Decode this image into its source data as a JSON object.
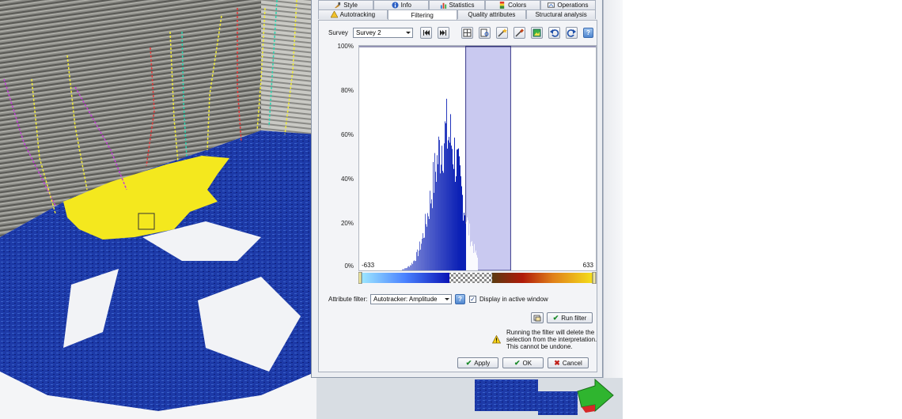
{
  "tabs_row1": [
    {
      "label": "Style",
      "icon": "brush-icon"
    },
    {
      "label": "Info",
      "icon": "info-icon"
    },
    {
      "label": "Statistics",
      "icon": "statistics-icon"
    },
    {
      "label": "Colors",
      "icon": "colors-icon"
    },
    {
      "label": "Operations",
      "icon": "operations-icon"
    }
  ],
  "tabs_row2": [
    {
      "label": "Autotracking",
      "icon": "autotracking-icon",
      "active": false
    },
    {
      "label": "Filtering",
      "icon": "",
      "active": true
    },
    {
      "label": "Quality attributes",
      "icon": "",
      "active": false
    },
    {
      "label": "Structural analysis",
      "icon": "",
      "active": false
    }
  ],
  "survey": {
    "label": "Survey",
    "value": "Survey 2"
  },
  "toolbar_icons": [
    "first-icon",
    "previous-icon",
    "grid-icon",
    "grid-zoom-icon",
    "wand-icon",
    "eyedropper-icon",
    "image-icon",
    "undo-icon",
    "redo-icon",
    "help-icon"
  ],
  "histogram": {
    "yticks": [
      "100%",
      "80%",
      "60%",
      "40%",
      "20%",
      "0%"
    ],
    "xmin_label": "-633",
    "xmax_label": "633",
    "selection_range": [
      0.45,
      0.64
    ],
    "colors": {
      "blue": "#0a1fb5",
      "selection": "#c9c9f0",
      "bar_light": "#ffffff"
    }
  },
  "attribute_filter": {
    "label": "Attribute filter:",
    "value": "Autotracker: Amplitude"
  },
  "display_active": {
    "label": "Display in active window",
    "checked": true
  },
  "run_filter": {
    "label": "Run filter"
  },
  "warning": {
    "line1": "Running the filter will delete the",
    "line2": "selection from the interpretation.",
    "line3": "This cannot be undone."
  },
  "footer": {
    "apply": "Apply",
    "ok": "OK",
    "cancel": "Cancel"
  },
  "colors": {
    "surface_blue": "#1b3fae",
    "surface_yellow": "#f4e81e",
    "dialog_bg": "#eceef2",
    "nav_green": "#2fb52f"
  }
}
